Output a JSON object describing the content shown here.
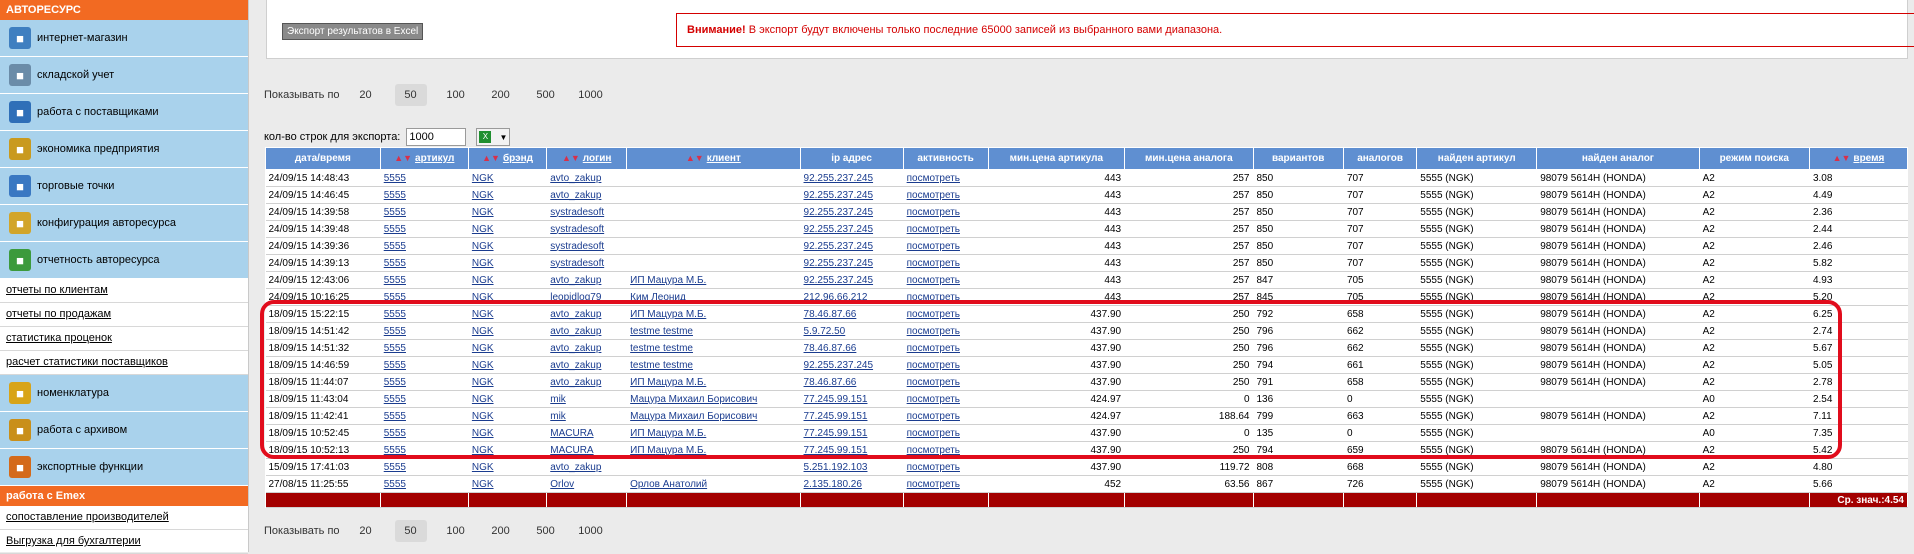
{
  "sidebar": {
    "header": "АВТОРЕСУРС",
    "items": [
      {
        "label": "интернет-магазин",
        "icon": "shop-icon",
        "color": "#3f7fc0"
      },
      {
        "label": "складской учет",
        "icon": "warehouse-icon",
        "color": "#6b8ca8"
      },
      {
        "label": "работа с поставщиками",
        "icon": "truck-icon",
        "color": "#2f6fb8"
      },
      {
        "label": "экономика предприятия",
        "icon": "coins-icon",
        "color": "#c99a1f"
      },
      {
        "label": "торговые точки",
        "icon": "store-icon",
        "color": "#3a78c2"
      },
      {
        "label": "конфигурация авторесурса",
        "icon": "config-icon",
        "color": "#d2a52a"
      },
      {
        "label": "отчетность авторесурса",
        "icon": "report-icon",
        "color": "#3c9a3c"
      }
    ],
    "links": [
      "отчеты по клиентам",
      "отчеты по продажам",
      "статистика проценок",
      "расчет статистики поставщиков"
    ],
    "items2": [
      {
        "label": "номенклатура",
        "icon": "nomenclature-icon",
        "color": "#d8a418"
      },
      {
        "label": "работа с архивом",
        "icon": "archive-icon",
        "color": "#c98f1a"
      },
      {
        "label": "экспортные функции",
        "icon": "export-icon",
        "color": "#d46a1a"
      }
    ],
    "header2": "работа с Emex",
    "links2": [
      "сопоставление производителей",
      "Выгрузка для бухгалтерии"
    ]
  },
  "top": {
    "export_button": "Экспорт результатов в Excel",
    "warning_bold": "Внимание!",
    "warning_text": " В экспорт будут включены только последние 65000 записей из выбранного вами диапазона."
  },
  "pager": {
    "label": "Показывать по",
    "options": [
      "20",
      "50",
      "100",
      "200",
      "500",
      "1000"
    ],
    "selected": "50"
  },
  "export_rows": {
    "label": "кол-во строк для экспорта:",
    "value": "1000"
  },
  "table": {
    "headers": [
      "дата/время",
      "артикул",
      "брэнд",
      "логин",
      "клиент",
      "ip адрес",
      "активность",
      "мин.цена артикула",
      "мин.цена аналога",
      "вариантов",
      "аналогов",
      "найден артикул",
      "найден аналог",
      "режим поиска",
      "время"
    ],
    "sortable": [
      false,
      true,
      true,
      true,
      true,
      false,
      false,
      false,
      false,
      false,
      false,
      false,
      false,
      false,
      true
    ],
    "rows": [
      [
        "24/09/15 14:48:43",
        "5555",
        "NGK",
        "avto_zakup",
        "",
        "92.255.237.245",
        "посмотреть",
        "443",
        "257",
        "850",
        "707",
        "5555 (NGK)",
        "98079 5614H (HONDA)",
        "A2",
        "3.08"
      ],
      [
        "24/09/15 14:46:45",
        "5555",
        "NGK",
        "avto_zakup",
        "",
        "92.255.237.245",
        "посмотреть",
        "443",
        "257",
        "850",
        "707",
        "5555 (NGK)",
        "98079 5614H (HONDA)",
        "A2",
        "4.49"
      ],
      [
        "24/09/15 14:39:58",
        "5555",
        "NGK",
        "systradesoft",
        "",
        "92.255.237.245",
        "посмотреть",
        "443",
        "257",
        "850",
        "707",
        "5555 (NGK)",
        "98079 5614H (HONDA)",
        "A2",
        "2.36"
      ],
      [
        "24/09/15 14:39:48",
        "5555",
        "NGK",
        "systradesoft",
        "",
        "92.255.237.245",
        "посмотреть",
        "443",
        "257",
        "850",
        "707",
        "5555 (NGK)",
        "98079 5614H (HONDA)",
        "A2",
        "2.44"
      ],
      [
        "24/09/15 14:39:36",
        "5555",
        "NGK",
        "systradesoft",
        "",
        "92.255.237.245",
        "посмотреть",
        "443",
        "257",
        "850",
        "707",
        "5555 (NGK)",
        "98079 5614H (HONDA)",
        "A2",
        "2.46"
      ],
      [
        "24/09/15 14:39:13",
        "5555",
        "NGK",
        "systradesoft",
        "",
        "92.255.237.245",
        "посмотреть",
        "443",
        "257",
        "850",
        "707",
        "5555 (NGK)",
        "98079 5614H (HONDA)",
        "A2",
        "5.82"
      ],
      [
        "24/09/15 12:43:06",
        "5555",
        "NGK",
        "avto_zakup",
        "ИП Мацура М.Б.",
        "92.255.237.245",
        "посмотреть",
        "443",
        "257",
        "847",
        "705",
        "5555 (NGK)",
        "98079 5614H (HONDA)",
        "A2",
        "4.93"
      ],
      [
        "24/09/15 10:16:25",
        "5555",
        "NGK",
        "leopidlog79",
        "Ким Леонид",
        "212.96.66.212",
        "посмотреть",
        "443",
        "257",
        "845",
        "705",
        "5555 (NGK)",
        "98079 5614H (HONDA)",
        "A2",
        "5.20"
      ],
      [
        "18/09/15 15:22:15",
        "5555",
        "NGK",
        "avto_zakup",
        "ИП Мацура М.Б.",
        "78.46.87.66",
        "посмотреть",
        "437.90",
        "250",
        "792",
        "658",
        "5555 (NGK)",
        "98079 5614H (HONDA)",
        "A2",
        "6.25"
      ],
      [
        "18/09/15 14:51:42",
        "5555",
        "NGK",
        "avto_zakup",
        "testme testme",
        "5.9.72.50",
        "посмотреть",
        "437.90",
        "250",
        "796",
        "662",
        "5555 (NGK)",
        "98079 5614H (HONDA)",
        "A2",
        "2.74"
      ],
      [
        "18/09/15 14:51:32",
        "5555",
        "NGK",
        "avto_zakup",
        "testme testme",
        "78.46.87.66",
        "посмотреть",
        "437.90",
        "250",
        "796",
        "662",
        "5555 (NGK)",
        "98079 5614H (HONDA)",
        "A2",
        "5.67"
      ],
      [
        "18/09/15 14:46:59",
        "5555",
        "NGK",
        "avto_zakup",
        "testme testme",
        "92.255.237.245",
        "посмотреть",
        "437.90",
        "250",
        "794",
        "661",
        "5555 (NGK)",
        "98079 5614H (HONDA)",
        "A2",
        "5.05"
      ],
      [
        "18/09/15 11:44:07",
        "5555",
        "NGK",
        "avto_zakup",
        "ИП Мацура М.Б.",
        "78.46.87.66",
        "посмотреть",
        "437.90",
        "250",
        "791",
        "658",
        "5555 (NGK)",
        "98079 5614H (HONDA)",
        "A2",
        "2.78"
      ],
      [
        "18/09/15 11:43:04",
        "5555",
        "NGK",
        "mik",
        "Мацура Михаил Борисович",
        "77.245.99.151",
        "посмотреть",
        "424.97",
        "0",
        "136",
        "0",
        "5555 (NGK)",
        "",
        "A0",
        "2.54"
      ],
      [
        "18/09/15 11:42:41",
        "5555",
        "NGK",
        "mik",
        "Мацура Михаил Борисович",
        "77.245.99.151",
        "посмотреть",
        "424.97",
        "188.64",
        "799",
        "663",
        "5555 (NGK)",
        "98079 5614H (HONDA)",
        "A2",
        "7.11"
      ],
      [
        "18/09/15 10:52:45",
        "5555",
        "NGK",
        "MACURA",
        "ИП Мацура М.Б.",
        "77.245.99.151",
        "посмотреть",
        "437.90",
        "0",
        "135",
        "0",
        "5555 (NGK)",
        "",
        "A0",
        "7.35"
      ],
      [
        "18/09/15 10:52:13",
        "5555",
        "NGK",
        "MACURA",
        "ИП Мацура М.Б.",
        "77.245.99.151",
        "посмотреть",
        "437.90",
        "250",
        "794",
        "659",
        "5555 (NGK)",
        "98079 5614H (HONDA)",
        "A2",
        "5.42"
      ],
      [
        "15/09/15 17:41:03",
        "5555",
        "NGK",
        "avto_zakup",
        "",
        "5.251.192.103",
        "посмотреть",
        "437.90",
        "119.72",
        "808",
        "668",
        "5555 (NGK)",
        "98079 5614H (HONDA)",
        "A2",
        "4.80"
      ],
      [
        "27/08/15 11:25:55",
        "5555",
        "NGK",
        "Orlov",
        "Орлов Анатолий",
        "2.135.180.26",
        "посмотреть",
        "452",
        "63.56",
        "867",
        "726",
        "5555 (NGK)",
        "98079 5614H (HONDA)",
        "A2",
        "5.66"
      ]
    ],
    "footer": "Ср. знач.:4.54"
  },
  "colors": {
    "accent": "#f26a22",
    "header": "#5f8fd1",
    "highlight": "#e10c1c",
    "footer": "#a30000"
  }
}
